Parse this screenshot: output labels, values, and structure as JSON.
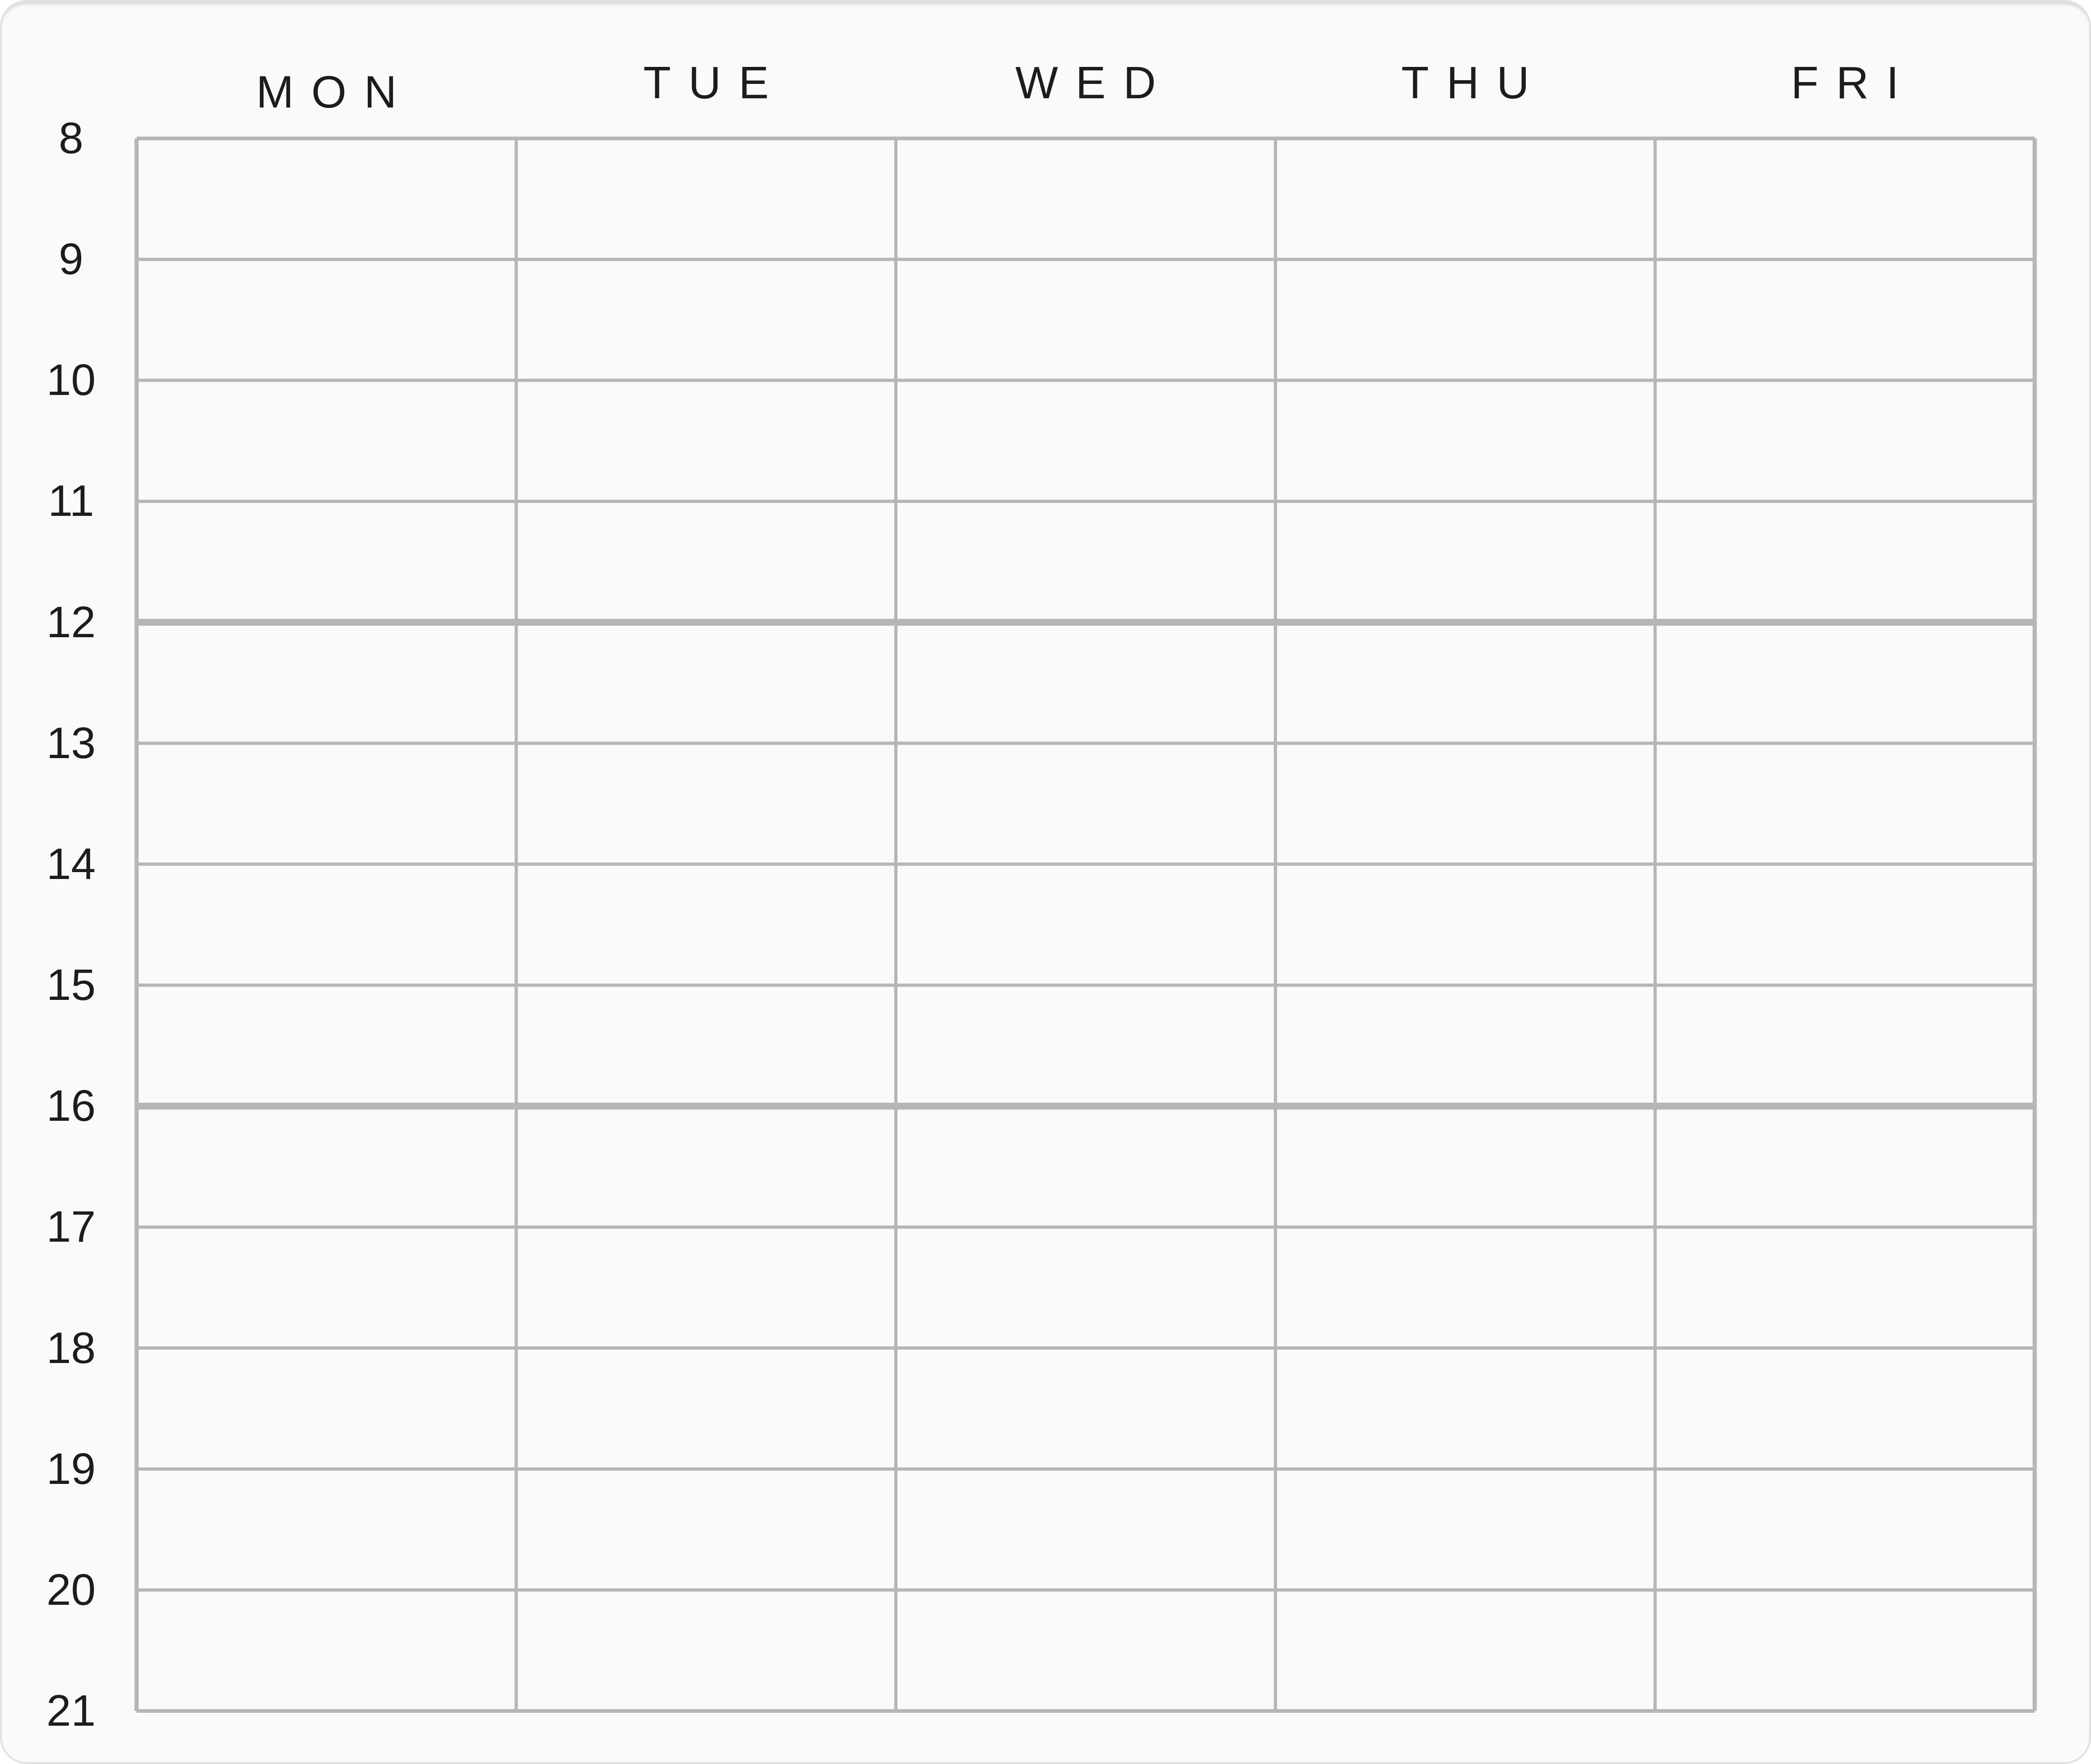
{
  "days": [
    "MON",
    "TUE",
    "WED",
    "THU",
    "FRI"
  ],
  "hours": [
    "8",
    "9",
    "10",
    "11",
    "12",
    "13",
    "14",
    "15",
    "16",
    "17",
    "18",
    "19",
    "20",
    "21"
  ],
  "emphasized_hours": [
    "12",
    "16"
  ],
  "colors": {
    "background": "#fbfaf8",
    "grid_line": "#b7b6b6",
    "text": "#1c1c1c"
  }
}
